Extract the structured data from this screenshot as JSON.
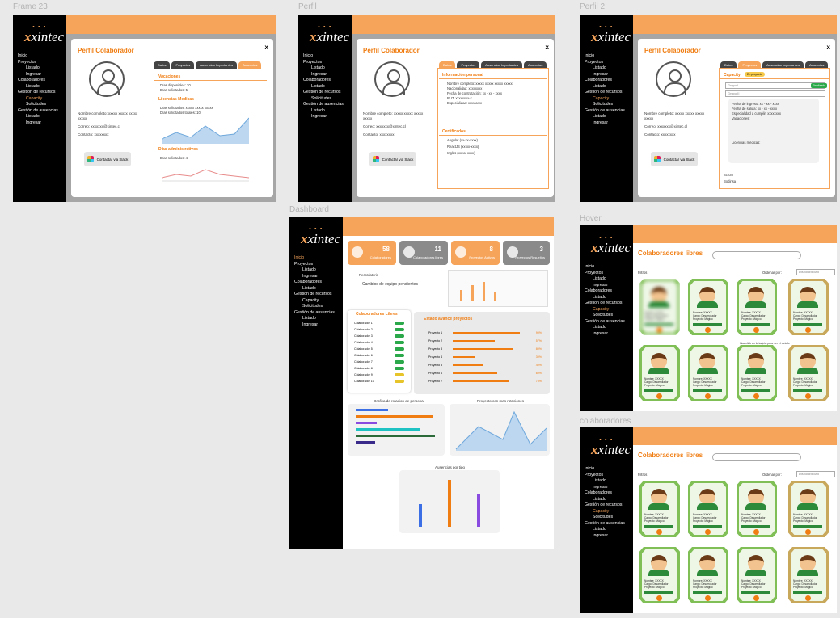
{
  "labels": {
    "frame23": "Frame 23",
    "perfil": "Perfil",
    "perfil2": "Perfil 2",
    "dashboard": "Dashboard",
    "hover": "Hover",
    "colaboradores": "colaboradores"
  },
  "brand": "xintec",
  "nav": {
    "inicio": "Inicio",
    "proyectos": "Proyectos",
    "listado": "Listado",
    "ingresar": "Ingresar",
    "colaboradores": "Colaboradores",
    "gestion_recursos": "Gestión de recursos",
    "capacity": "Capacity",
    "solicitudes": "Solicitudes",
    "gestion_ausencias": "Gestión de ausencias"
  },
  "modal": {
    "title": "Perfil Colaborador",
    "close": "x",
    "nombre": "Nombre completo: xxxxx xxxxx xxxxx xxxxx",
    "correo": "Correo: xxxxxxx@xintec.cl",
    "contacto": "Contacto: xxxxxxxx",
    "slack": "Contactar via Slack"
  },
  "tabs": [
    "Datos",
    "Proyectos",
    "Ausencias Importantes",
    "Ausencias"
  ],
  "frame23": {
    "vac": "Vacaciones",
    "vac1": "Días disponibles: 20",
    "vac2": "Días solicitados: 5",
    "lic": "Licencias Medicas",
    "lic1": "Días solicitados: xxxxx xxxxx xxxxx",
    "lic2": "Días solicitados totales: 10",
    "adm": "Días administrativos",
    "adm1": "Días solicitados: 4"
  },
  "perfil": {
    "info": "Información personal",
    "n": "Nombre completo: xxxxx xxxxx xxxxx xxxxx",
    "nac": "Nacionalidad: xxxxxxxx",
    "fecha": "Fecha de contratación: xx - xx - xxxx",
    "rut": "RUT: xxxxxxxx-x",
    "esp": "Especialidad: xxxxxxxx",
    "cert": "Certificados",
    "c1": "Angular (xx-xx-xxxx)",
    "c2": "ReactJS (xx-xx-xxxx)",
    "c3": "Inglés (xx-xx-xxxx)"
  },
  "perfil2": {
    "capacity": "Capacity",
    "badge": "En proyecto",
    "p1": "Grupo I",
    "p2": "Grupo II",
    "estado": "Finalizado",
    "ingreso": "Fecha de ingreso: xx - xx - xxxx",
    "salida": "Fecha de salida: xx - xx - xxxx",
    "esp": "Especialidad a cumplir: xxxxxxxx",
    "vac": "Vacaciones:",
    "lic": "Licencias médicas:",
    "scrum": "Scrum",
    "bodinsa": "Bodinsa"
  },
  "dashboard": {
    "stats": [
      {
        "n": "58",
        "l": "Colaboradores"
      },
      {
        "n": "11",
        "l": "Colaboradores libres"
      },
      {
        "n": "8",
        "l": "Proyectos Activos"
      },
      {
        "n": "3",
        "l": "Proyectos Resueltos"
      }
    ],
    "recordatorio": "Recordatorio",
    "cambios": "Cambios de equipo pendientes",
    "libres": "Colaboradores Libres",
    "estado": "Estado avance proyectos",
    "rotacion": "Grafica de rotacion de personal",
    "mas": "Proyecto con mas rotaciones",
    "ausencias": "Ausencias por tipo",
    "colabs": [
      "Colaborador 1",
      "Colaborador 2",
      "Colaborador 3",
      "Colaborador 4",
      "Colaborador 5",
      "Colaborador 6",
      "Colaborador 7",
      "Colaborador 8",
      "Colaborador 9",
      "Colaborador 10"
    ],
    "proyectos": [
      "Proyecto 1",
      "Proyecto 2",
      "Proyecto 3",
      "Proyecto 4",
      "Proyecto 5",
      "Proyecto 6",
      "Proyecto 7"
    ],
    "pcts": [
      "90%",
      "57%",
      "80%",
      "30%",
      "40%",
      "60%",
      "75%"
    ],
    "pvals": [
      0.9,
      0.57,
      0.8,
      0.3,
      0.4,
      0.6,
      0.75
    ]
  },
  "libres": {
    "title": "Colaboradores libres",
    "filtros": "Filtros",
    "ordenar": "Ordenar por:",
    "disp": "Disponibilidad",
    "card1": "Nombre: XXXXX",
    "card2": "Cargo: Desarrollador",
    "card3": "Proyecto: Mágico",
    "hoverhint": "Haz click en la tarjeta para ver el detalle"
  }
}
